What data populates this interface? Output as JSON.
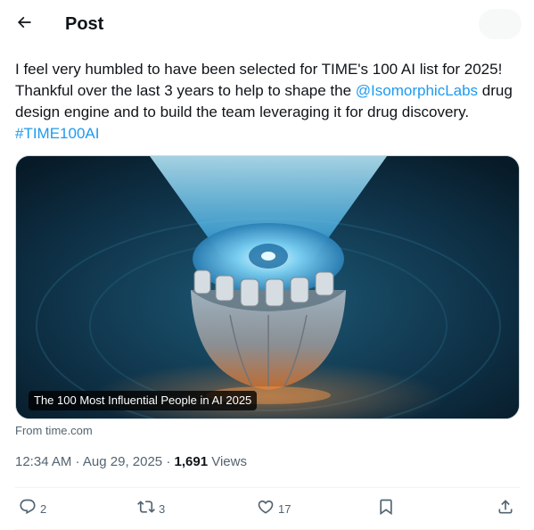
{
  "header": {
    "title": "Post",
    "back_icon": "arrow-left-icon"
  },
  "tweet": {
    "text_part1": "I feel very humbled to have been selected for TIME's 100 AI list for 2025! Thankful over the last 3 years to help to shape the ",
    "mention": "@IsomorphicLabs",
    "text_part2": " drug design engine and to build the team leveraging it for drug discovery.",
    "hashtag": "#TIME100AI"
  },
  "media": {
    "caption": "The 100 Most Influential People in AI 2025"
  },
  "source": "From time.com",
  "meta": {
    "time": "12:34 AM",
    "sep1": " · ",
    "date": "Aug 29, 2025",
    "sep2": " · ",
    "views_count": "1,691",
    "views_label": " Views"
  },
  "actions": {
    "replies": "2",
    "reposts": "3",
    "likes": "17"
  },
  "colors": {
    "link": "#1d9bf0",
    "muted": "#536471",
    "text": "#0f1419"
  }
}
